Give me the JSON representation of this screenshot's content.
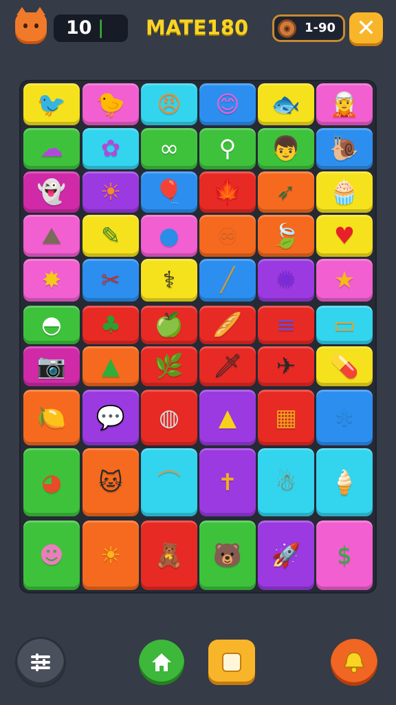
{
  "header": {
    "score": "10",
    "title": "MATE180",
    "level": "1-90",
    "close_symbol": "✕"
  },
  "colors": {
    "yellow": "#f6e21c",
    "pink": "#f15fd0",
    "cyan": "#33d4ee",
    "blue": "#2c8ff0",
    "green": "#3ec23c",
    "magenta": "#d02aa8",
    "purple": "#9a3ae0",
    "orange": "#f56a1e",
    "red": "#e82a24"
  },
  "board": {
    "rows": [
      [
        {
          "color": "yellow",
          "icon": "bird-icon"
        },
        {
          "color": "pink",
          "icon": "chick-icon"
        },
        {
          "color": "cyan",
          "icon": "orange-face-icon"
        },
        {
          "color": "blue",
          "icon": "pink-blob-icon"
        },
        {
          "color": "yellow",
          "icon": "blue-fish-icon"
        },
        {
          "color": "pink",
          "icon": "elf-face-icon"
        }
      ],
      [
        {
          "color": "green",
          "icon": "purple-cloud-icon"
        },
        {
          "color": "cyan",
          "icon": "purple-bush-icon"
        },
        {
          "color": "green",
          "icon": "knot-icon"
        },
        {
          "color": "green",
          "icon": "key-icon"
        },
        {
          "color": "green",
          "icon": "boy-face-icon"
        },
        {
          "color": "blue",
          "icon": "snail-icon"
        }
      ],
      [
        {
          "color": "magenta",
          "icon": "white-ghost-icon"
        },
        {
          "color": "purple",
          "icon": "orange-sun-face-icon"
        },
        {
          "color": "blue",
          "icon": "balloon-icon"
        },
        {
          "color": "red",
          "icon": "leaf-fox-icon"
        },
        {
          "color": "orange",
          "icon": "arrow-icon"
        },
        {
          "color": "yellow",
          "icon": "cupcake-icon"
        }
      ],
      [
        {
          "color": "pink",
          "icon": "rock-face-icon"
        },
        {
          "color": "yellow",
          "icon": "wand-icon"
        },
        {
          "color": "pink",
          "icon": "blue-blob-icon"
        },
        {
          "color": "orange",
          "icon": "pretzel-icon"
        },
        {
          "color": "orange",
          "icon": "green-leaf-icon"
        },
        {
          "color": "yellow",
          "icon": "heart-icon"
        }
      ],
      [
        {
          "color": "pink",
          "icon": "yellow-splat-icon"
        },
        {
          "color": "blue",
          "icon": "cross-tools-icon"
        },
        {
          "color": "yellow",
          "icon": "pink-bone-icon"
        },
        {
          "color": "blue",
          "icon": "stick-icon"
        },
        {
          "color": "purple",
          "icon": "virus-icon"
        },
        {
          "color": "pink",
          "icon": "star-face-icon"
        }
      ],
      [
        {
          "color": "green",
          "icon": "small-ghost-icon"
        },
        {
          "color": "red",
          "icon": "green-bush-icon"
        },
        {
          "color": "red",
          "icon": "green-apple-icon"
        },
        {
          "color": "red",
          "icon": "bread-loaf-icon"
        },
        {
          "color": "red",
          "icon": "stacked-discs-icon"
        },
        {
          "color": "cyan",
          "icon": "bandage-icon"
        }
      ],
      [
        {
          "color": "magenta",
          "icon": "camera-icon"
        },
        {
          "color": "orange",
          "icon": "pyramid-icon"
        },
        {
          "color": "red",
          "icon": "sprout-icon"
        },
        {
          "color": "red",
          "icon": "sword-icon"
        },
        {
          "color": "red",
          "icon": "airplane-icon"
        },
        {
          "color": "yellow",
          "icon": "capsule-icon"
        }
      ],
      [
        {
          "color": "orange",
          "icon": "lemon-icon"
        },
        {
          "color": "purple",
          "icon": "speech-bubble-icon"
        },
        {
          "color": "red",
          "icon": "gray-blob-icon"
        },
        {
          "color": "purple",
          "icon": "yellow-drop-icon"
        },
        {
          "color": "red",
          "icon": "barrel-icon"
        },
        {
          "color": "blue",
          "icon": "blue-puff-icon"
        }
      ],
      [
        {
          "color": "green",
          "icon": "beach-ball-icon"
        },
        {
          "color": "orange",
          "icon": "pink-cat-icon"
        },
        {
          "color": "cyan",
          "icon": "hammock-icon"
        },
        {
          "color": "purple",
          "icon": "torch-icon"
        },
        {
          "color": "cyan",
          "icon": "gingerbread-icon"
        },
        {
          "color": "cyan",
          "icon": "ice-cream-icon"
        }
      ],
      [
        {
          "color": "green",
          "icon": "pink-face-icon"
        },
        {
          "color": "orange",
          "icon": "sun-icon"
        },
        {
          "color": "red",
          "icon": "teddy-icon"
        },
        {
          "color": "green",
          "icon": "bear-face-icon"
        },
        {
          "color": "purple",
          "icon": "rocket-icon"
        },
        {
          "color": "pink",
          "icon": "dollar-coin-icon"
        }
      ]
    ]
  },
  "footer": {
    "menu_icon": "sliders-icon",
    "home_icon": "home-icon",
    "square_icon": "square-icon",
    "hint_icon": "bell-icon"
  }
}
